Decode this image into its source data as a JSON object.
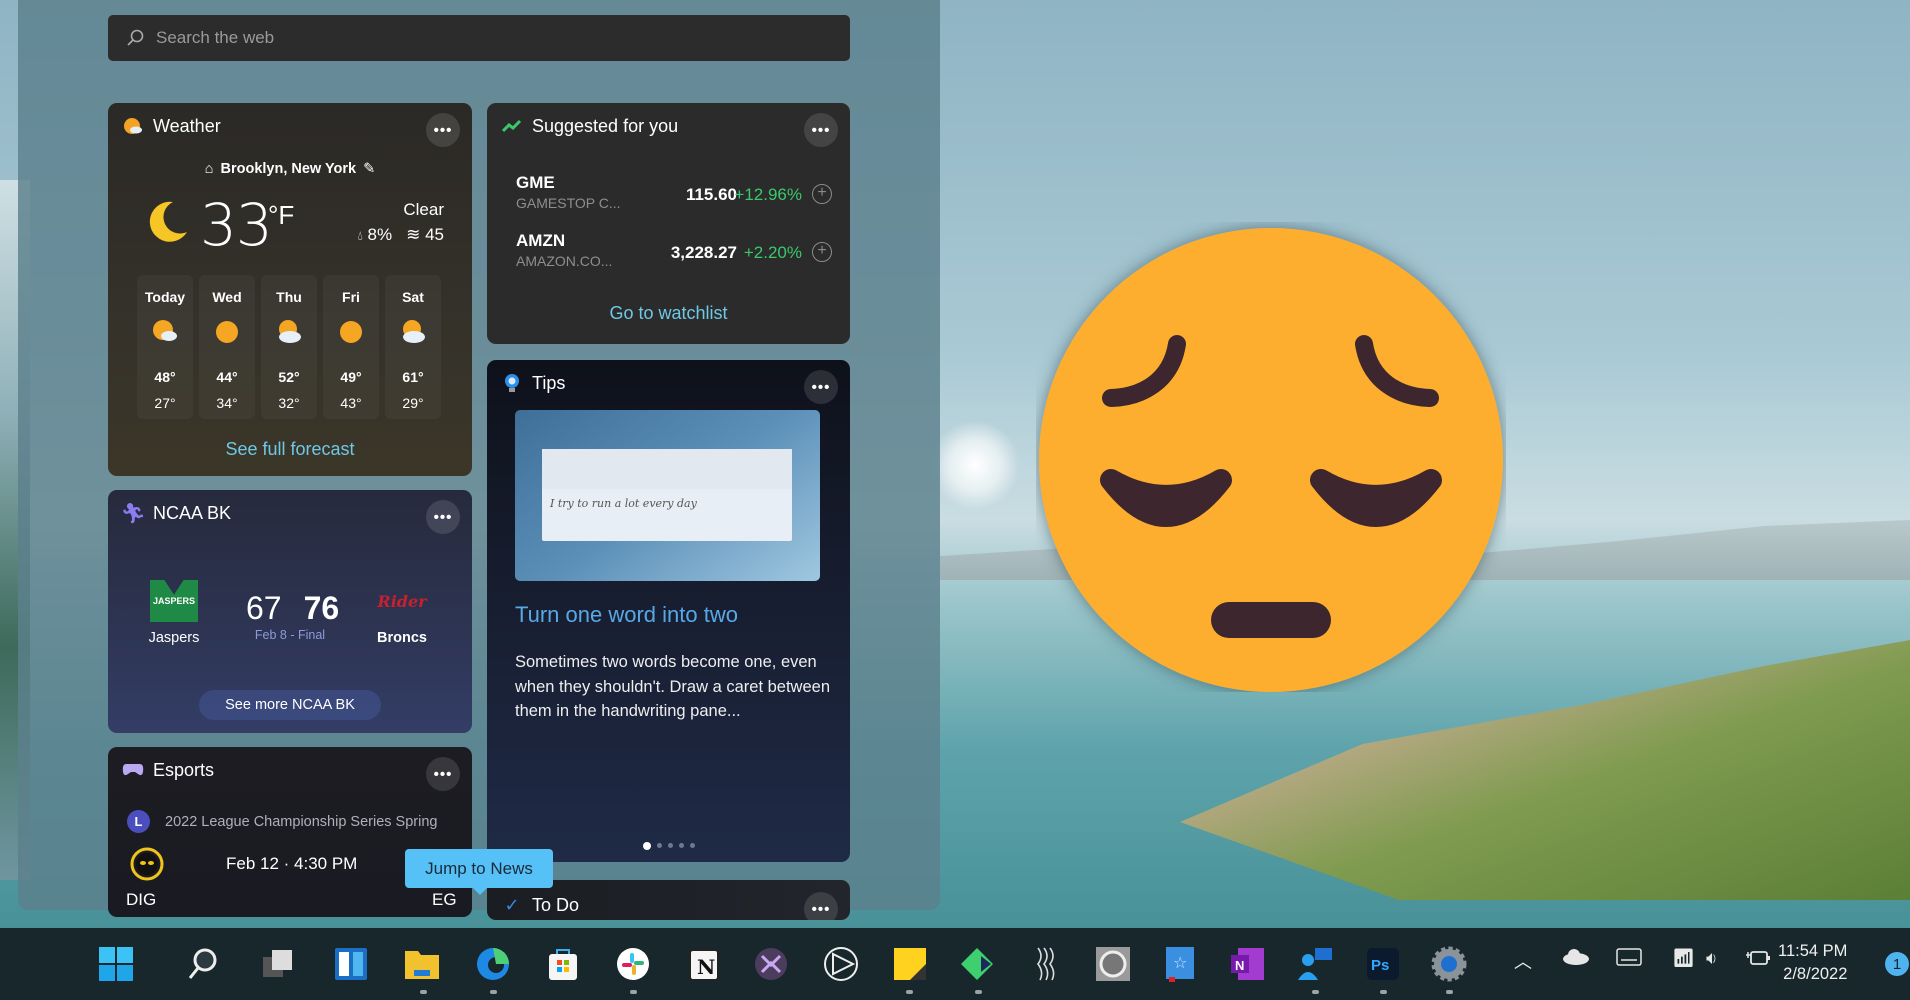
{
  "search": {
    "placeholder": "Search the web"
  },
  "weather": {
    "title": "Weather",
    "location": "Brooklyn, New York",
    "temperature": "33",
    "unit": "°F",
    "condition": "Clear",
    "precipitation": "8%",
    "wind": "45",
    "forecast": [
      {
        "day": "Today",
        "icon": "partly-cloudy-icon",
        "high": "48°",
        "low": "27°"
      },
      {
        "day": "Wed",
        "icon": "sunny-icon",
        "high": "44°",
        "low": "34°"
      },
      {
        "day": "Thu",
        "icon": "partly-cloudy-icon",
        "high": "52°",
        "low": "32°"
      },
      {
        "day": "Fri",
        "icon": "sunny-icon",
        "high": "49°",
        "low": "43°"
      },
      {
        "day": "Sat",
        "icon": "partly-cloudy-icon",
        "high": "61°",
        "low": "29°"
      }
    ],
    "link": "See full forecast"
  },
  "stocks": {
    "title": "Suggested for you",
    "items": [
      {
        "symbol": "GME",
        "name": "GAMESTOP C...",
        "price": "115.60",
        "change": "+12.96%"
      },
      {
        "symbol": "AMZN",
        "name": "AMAZON.CO...",
        "price": "3,228.27",
        "change": "+2.20%"
      }
    ],
    "link": "Go to watchlist"
  },
  "ncaa": {
    "title": "NCAA BK",
    "home": {
      "name": "Jaspers",
      "score": "67",
      "logo_text": "JASPERS"
    },
    "away": {
      "name": "Broncs",
      "score": "76",
      "logo_text": "Rider"
    },
    "status": "Feb 8 - Final",
    "button": "See more NCAA BK"
  },
  "esports": {
    "title": "Esports",
    "league_badge": "L",
    "league": "2022 League Championship Series Spring",
    "time": "Feb 12 · 4:30 PM",
    "team1": "DIG",
    "team2": "EG"
  },
  "tooltip": {
    "label": "Jump to News"
  },
  "tips": {
    "title": "Tips",
    "image_text": "I try to run a lot every day",
    "headline": "Turn one word into two",
    "body": "Sometimes two words become one, even when they shouldn't. Draw a caret between them in the handwriting pane...",
    "page_count": 5,
    "current_page": 1
  },
  "todo": {
    "title": "To Do"
  },
  "more_label": "•••",
  "colors": {
    "accent_link": "#6fc8e6",
    "positive": "#3ac96a",
    "tooltip": "#56c1f6",
    "emoji": "#fdae2d"
  },
  "taskbar": {
    "apps": [
      {
        "name": "start",
        "running": false
      },
      {
        "name": "search",
        "running": false
      },
      {
        "name": "task-view",
        "running": false
      },
      {
        "name": "widgets",
        "running": false
      },
      {
        "name": "file-explorer",
        "running": true
      },
      {
        "name": "edge",
        "running": true
      },
      {
        "name": "microsoft-store",
        "running": false
      },
      {
        "name": "slack",
        "running": true
      },
      {
        "name": "notion",
        "running": false
      },
      {
        "name": "app-purple",
        "running": false
      },
      {
        "name": "app-triangle",
        "running": false
      },
      {
        "name": "sticky-notes",
        "running": true
      },
      {
        "name": "app-green-diamond",
        "running": true
      },
      {
        "name": "app-waves",
        "running": false
      },
      {
        "name": "app-silver",
        "running": false
      },
      {
        "name": "app-book",
        "running": false
      },
      {
        "name": "onenote",
        "running": false
      },
      {
        "name": "people",
        "running": true
      },
      {
        "name": "photoshop",
        "running": true
      },
      {
        "name": "settings",
        "running": true
      }
    ],
    "time": "11:54 PM",
    "date": "2/8/2022",
    "notification_count": "1"
  }
}
